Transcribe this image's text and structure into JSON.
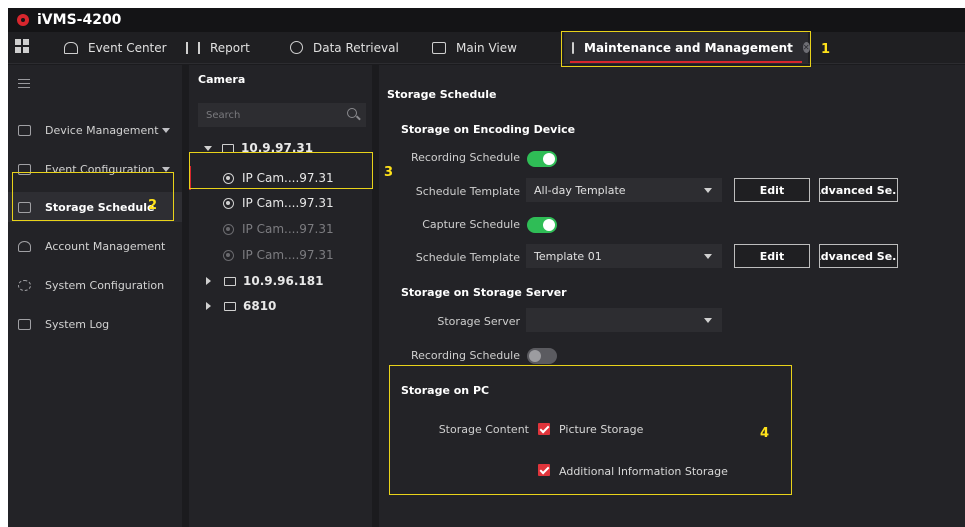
{
  "app": {
    "title": "iVMS-4200"
  },
  "tabs": [
    {
      "label": "Event Center",
      "icon": "bell-icon"
    },
    {
      "label": "Report",
      "icon": "bar-chart-icon"
    },
    {
      "label": "Data Retrieval",
      "icon": "search-circle-icon"
    },
    {
      "label": "Main View",
      "icon": "monitor-icon"
    },
    {
      "label": "Maintenance and Management",
      "icon": "maintenance-icon",
      "active": true
    }
  ],
  "sidebar": {
    "items": [
      {
        "label": "Device Management",
        "icon": "device-icon",
        "expandable": true
      },
      {
        "label": "Event Configuration",
        "icon": "event-config-icon",
        "expandable": true
      },
      {
        "label": "Storage Schedule",
        "icon": "storage-icon",
        "active": true
      },
      {
        "label": "Account Management",
        "icon": "person-icon"
      },
      {
        "label": "System Configuration",
        "icon": "gear-icon"
      },
      {
        "label": "System Log",
        "icon": "log-icon"
      }
    ]
  },
  "camera_panel": {
    "title": "Camera",
    "search_placeholder": "Search",
    "groups": [
      {
        "label": "10.9.97.31",
        "expanded": true,
        "cameras": [
          {
            "label": "IP Cam....97.31",
            "online": true,
            "selected": true
          },
          {
            "label": "IP Cam....97.31",
            "online": true
          },
          {
            "label": "IP Cam....97.31",
            "online": false
          },
          {
            "label": "IP Cam....97.31",
            "online": false
          }
        ]
      },
      {
        "label": "10.9.96.181",
        "expanded": false
      },
      {
        "label": "6810",
        "expanded": false
      }
    ]
  },
  "main": {
    "title": "Storage Schedule",
    "encoding": {
      "title": "Storage on Encoding Device",
      "recording_label": "Recording Schedule",
      "recording_on": true,
      "template_label": "Schedule Template",
      "template_value": "All-day Template",
      "edit_label": "Edit",
      "advanced_label": "Advanced Se...",
      "capture_label": "Capture Schedule",
      "capture_on": true,
      "template2_label": "Schedule Template",
      "template2_value": "Template 01",
      "edit2_label": "Edit",
      "advanced2_label": "Advanced Se..."
    },
    "server": {
      "title": "Storage on Storage Server",
      "server_label": "Storage Server",
      "server_value": "",
      "recording_label": "Recording Schedule",
      "recording_on": false
    },
    "pc": {
      "title": "Storage on PC",
      "content_label": "Storage Content",
      "picture_label": "Picture Storage",
      "picture_checked": true,
      "additional_label": "Additional Information Storage",
      "additional_checked": true
    }
  },
  "annotations": [
    "1",
    "2",
    "3",
    "4"
  ],
  "colors": {
    "accent": "#d7262d",
    "toggle_on": "#2fbd56",
    "annotation": "#e8d21a",
    "checkbox": "#e0343b"
  }
}
